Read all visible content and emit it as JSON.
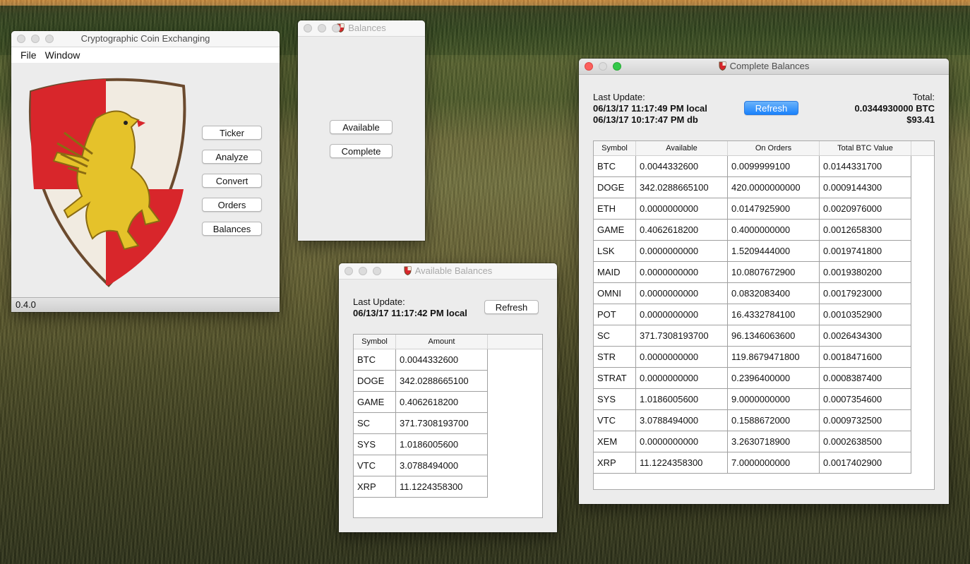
{
  "main_window": {
    "title": "Cryptographic Coin Exchanging",
    "menu": [
      "File",
      "Window"
    ],
    "buttons": {
      "ticker": "Ticker",
      "analyze": "Analyze",
      "convert": "Convert",
      "orders": "Orders",
      "balances": "Balances"
    },
    "version": "0.4.0"
  },
  "balances_window": {
    "title": "Balances",
    "available_label": "Available",
    "complete_label": "Complete"
  },
  "available_window": {
    "title": "Available Balances",
    "last_update_label": "Last Update:",
    "last_update_value": "06/13/17 11:17:42 PM local",
    "refresh_label": "Refresh",
    "columns": [
      "Symbol",
      "Amount"
    ],
    "rows": [
      [
        "BTC",
        "0.0044332600"
      ],
      [
        "DOGE",
        "342.0288665100"
      ],
      [
        "GAME",
        "0.4062618200"
      ],
      [
        "SC",
        "371.7308193700"
      ],
      [
        "SYS",
        "1.0186005600"
      ],
      [
        "VTC",
        "3.0788494000"
      ],
      [
        "XRP",
        "11.1224358300"
      ]
    ]
  },
  "complete_window": {
    "title": "Complete Balances",
    "last_update_label": "Last Update:",
    "last_update_local": "06/13/17 11:17:49 PM local",
    "last_update_db": "06/13/17 10:17:47 PM db",
    "refresh_label": "Refresh",
    "total_label": "Total:",
    "total_btc": "0.0344930000 BTC",
    "total_usd": "$93.41",
    "columns": [
      "Symbol",
      "Available",
      "On Orders",
      "Total BTC Value"
    ],
    "rows": [
      [
        "BTC",
        "0.0044332600",
        "0.0099999100",
        "0.0144331700"
      ],
      [
        "DOGE",
        "342.0288665100",
        "420.0000000000",
        "0.0009144300"
      ],
      [
        "ETH",
        "0.0000000000",
        "0.0147925900",
        "0.0020976000"
      ],
      [
        "GAME",
        "0.4062618200",
        "0.4000000000",
        "0.0012658300"
      ],
      [
        "LSK",
        "0.0000000000",
        "1.5209444000",
        "0.0019741800"
      ],
      [
        "MAID",
        "0.0000000000",
        "10.0807672900",
        "0.0019380200"
      ],
      [
        "OMNI",
        "0.0000000000",
        "0.0832083400",
        "0.0017923000"
      ],
      [
        "POT",
        "0.0000000000",
        "16.4332784100",
        "0.0010352900"
      ],
      [
        "SC",
        "371.7308193700",
        "96.1346063600",
        "0.0026434300"
      ],
      [
        "STR",
        "0.0000000000",
        "119.8679471800",
        "0.0018471600"
      ],
      [
        "STRAT",
        "0.0000000000",
        "0.2396400000",
        "0.0008387400"
      ],
      [
        "SYS",
        "1.0186005600",
        "9.0000000000",
        "0.0007354600"
      ],
      [
        "VTC",
        "3.0788494000",
        "0.1588672000",
        "0.0009732500"
      ],
      [
        "XEM",
        "0.0000000000",
        "3.2630718900",
        "0.0002638500"
      ],
      [
        "XRP",
        "11.1224358300",
        "7.0000000000",
        "0.0017402900"
      ]
    ]
  },
  "colors": {
    "accent": "#1a82fb",
    "shield_red": "#d8262b",
    "griffin_gold": "#e5c22a"
  }
}
